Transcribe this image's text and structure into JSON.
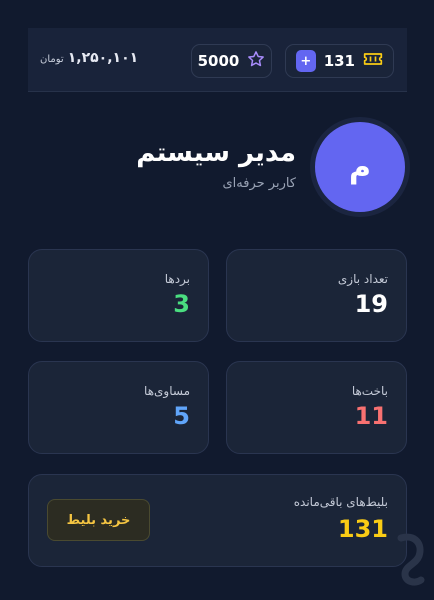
{
  "header": {
    "balance_amount": "۱,۲۵۰,۱۰۱",
    "balance_unit": "تومان",
    "stars": "5000",
    "tickets": "131",
    "plus_symbol": "+",
    "star_icon": "star-outline",
    "ticket_icon": "ticket"
  },
  "profile": {
    "avatar_letter": "م",
    "name": "مدیر سیستم",
    "role": "کاربر حرفه‌ای"
  },
  "stats": {
    "games": {
      "label": "تعداد بازی",
      "value": "19"
    },
    "wins": {
      "label": "بردها",
      "value": "3"
    },
    "losses": {
      "label": "باخت‌ها",
      "value": "11"
    },
    "draws": {
      "label": "مساوی‌ها",
      "value": "5"
    }
  },
  "tickets_card": {
    "label": "بلیط‌های باقی‌مانده",
    "value": "131",
    "buy_label": "خرید بلیط"
  },
  "colors": {
    "background": "#111a2e",
    "card": "#1b2538",
    "accent": "#6366f1",
    "white": "#ffffff",
    "win": "#4ade80",
    "loss": "#f87171",
    "draw": "#60a5fa",
    "ticket": "#facc15"
  }
}
